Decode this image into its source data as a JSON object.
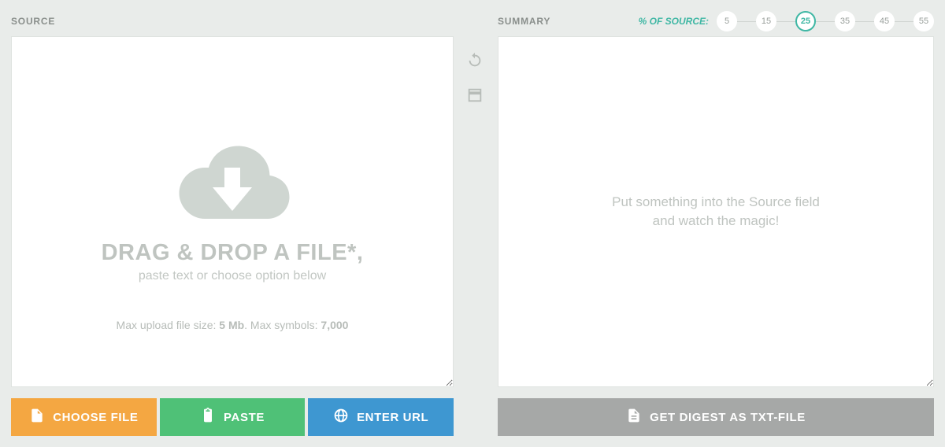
{
  "source": {
    "label": "SOURCE",
    "drop_heading": "DRAG & DROP A FILE*,",
    "drop_sub": "paste text or choose option below",
    "limit_prefix": "Max upload file size: ",
    "limit_size": "5 Mb",
    "limit_mid": ". Max symbols: ",
    "limit_symbols": "7,000"
  },
  "summary": {
    "label": "SUMMARY",
    "percent_label": "% OF SOURCE:",
    "percent_options": [
      "5",
      "15",
      "25",
      "35",
      "45",
      "55"
    ],
    "percent_selected": "25",
    "placeholder_line1": "Put something into the Source field",
    "placeholder_line2": "and watch the magic!"
  },
  "buttons": {
    "choose_file": "CHOOSE FILE",
    "paste": "PASTE",
    "enter_url": "ENTER URL",
    "get_digest": "GET DIGEST AS TXT-FILE"
  },
  "colors": {
    "accent": "#3fb7a4",
    "orange": "#f4a742",
    "green": "#4fc177",
    "blue": "#3e97d1",
    "gray": "#a6a8a7"
  }
}
